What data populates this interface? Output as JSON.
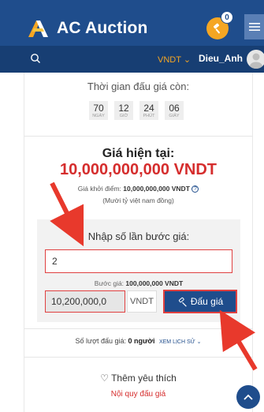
{
  "header": {
    "brand": "AC Auction",
    "notification_count": "0",
    "menu_icon": "hamburger-icon",
    "brand_color": "#1f4d8c"
  },
  "subbar": {
    "search_icon": "search-icon",
    "currency": "VNDT",
    "username": "Dieu_Anh"
  },
  "countdown": {
    "label": "Thời gian đấu giá còn:",
    "items": [
      {
        "value": "70",
        "unit": "NGÀY"
      },
      {
        "value": "12",
        "unit": "GIỜ"
      },
      {
        "value": "24",
        "unit": "PHÚT"
      },
      {
        "value": "06",
        "unit": "GIÂY"
      }
    ]
  },
  "price": {
    "label": "Giá hiện tại:",
    "value": "10,000,000,000 VNDT",
    "start_label": "Giá khởi điểm:",
    "start_value": "10,000,000,000 VNDT",
    "in_words": "(Mười tỷ việt nam đồng)",
    "accent_color": "#d52d2d"
  },
  "bid": {
    "title": "Nhập số lần bước giá:",
    "step_count": "2",
    "step_label": "Bước giá:",
    "step_value": "100,000,000 VNDT",
    "amount": "10,200,000,0",
    "unit": "VNDT",
    "button_label": "Đấu giá"
  },
  "stats": {
    "bid_count_label": "Số lượt đấu giá:",
    "bid_count_value": "0 người",
    "history_label": "XEM LỊCH SỬ"
  },
  "actions": {
    "favorite_label": "Thêm yêu thích",
    "rules_label": "Nội quy đấu giá"
  }
}
